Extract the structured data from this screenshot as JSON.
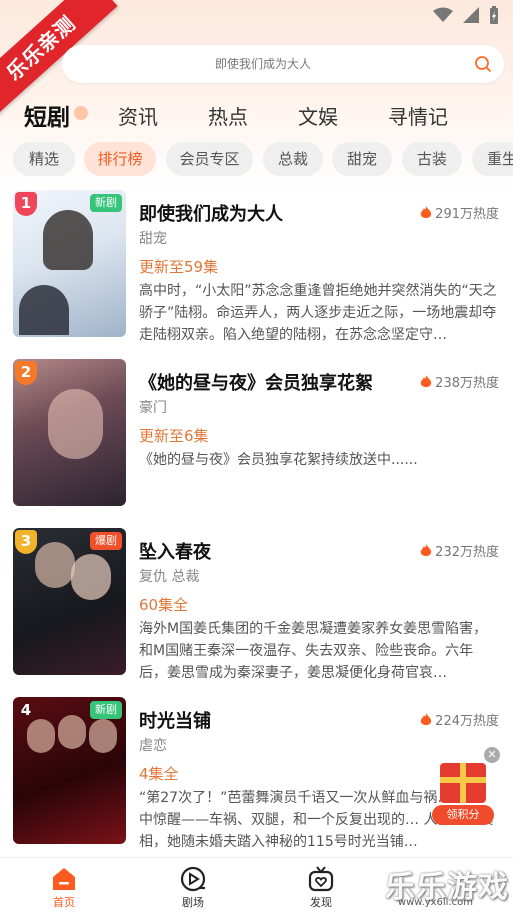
{
  "watermark_ribbon": "乐乐亲测",
  "search": {
    "placeholder": "即使我们成为大人",
    "icon": "search-icon"
  },
  "tabs": [
    "短剧",
    "资讯",
    "热点",
    "文娱",
    "寻情记"
  ],
  "chips": [
    "精选",
    "排行榜",
    "会员专区",
    "总裁",
    "甜宠",
    "古装",
    "重生"
  ],
  "active_chip": "排行榜",
  "items": [
    {
      "rank": "1",
      "badge": "新剧",
      "title": "即使我们成为大人",
      "heat": "291万热度",
      "genre": "甜宠",
      "update": "更新至59集",
      "desc": "高中时，“小太阳”苏念念重逢曾拒绝她并突然消失的“天之骄子”陆栩。命运弄人，两人逐步走近之际，一场地震却夺走陆栩双亲。陷入绝望的陆栩，在苏念念坚定守…"
    },
    {
      "rank": "2",
      "badge": "",
      "title": "《她的昼与夜》会员独享花絮",
      "heat": "238万热度",
      "genre": "豪门",
      "update": "更新至6集",
      "desc": "《她的昼与夜》会员独享花絮持续放送中......"
    },
    {
      "rank": "3",
      "badge": "爆剧",
      "title": "坠入春夜",
      "heat": "232万热度",
      "genre": "复仇 总裁",
      "update": "60集全",
      "desc": "海外M国姜氏集团的千金姜思凝遭姜家养女姜思雪陷害，和M国赌王秦深一夜温存、失去双亲、险些丧命。六年后，姜思雪成为秦深妻子，姜思凝便化身荷官哀…"
    },
    {
      "rank": "4",
      "badge": "新剧",
      "title": "时光当铺",
      "heat": "224万热度",
      "genre": "虐恋",
      "update": "4集全",
      "desc": "“第27次了！”芭蕾舞演员千语又一次从鲜血与祸… 梦境中惊醒——车祸、双腿，和一个反复出现的… 人。为寻真相，她随未婚夫踏入神秘的115号时光当铺…"
    }
  ],
  "float_label": "领积分",
  "nav": [
    "首页",
    "剧场",
    "发现"
  ],
  "watermark": "乐乐游戏",
  "watermark_url": "www.yx6ll.com",
  "colors": {
    "accent": "#ff5a1f",
    "update": "#e0783a"
  }
}
